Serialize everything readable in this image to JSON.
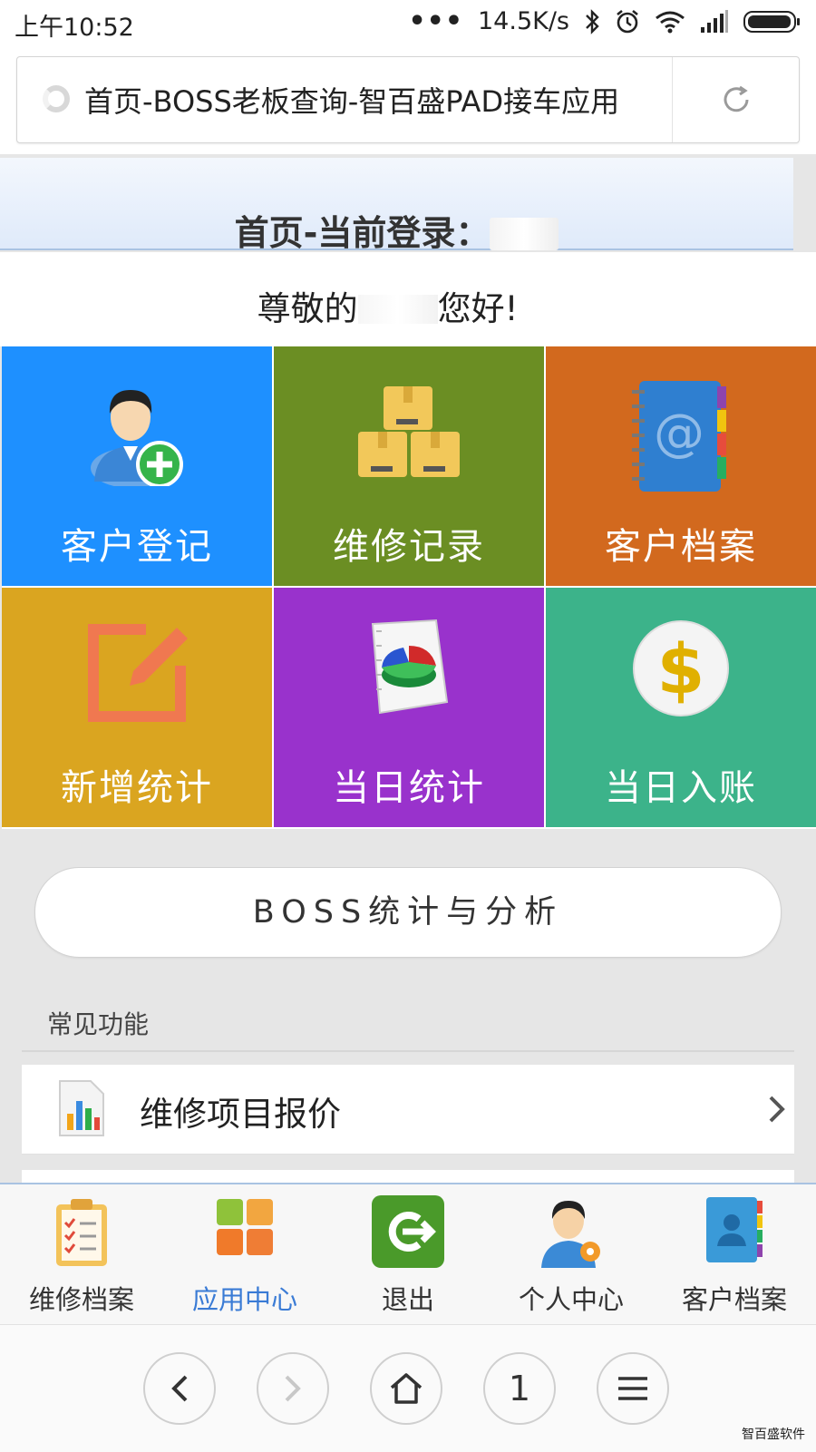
{
  "status_bar": {
    "time": "上午10:52",
    "dots": "•••",
    "network_speed": "14.5K/s",
    "icons": [
      "bluetooth-icon",
      "alarm-icon",
      "wifi-icon",
      "signal-icon",
      "battery-icon"
    ]
  },
  "browser": {
    "page_title": "首页-BOSS老板查询-智百盛PAD接车应用"
  },
  "header": {
    "title_prefix": "首页-当前登录："
  },
  "greeting": {
    "prefix": "尊敬的",
    "suffix": "您好!"
  },
  "tiles": [
    {
      "label": "客户登记",
      "color": "#1e90ff",
      "icon": "add-user-icon"
    },
    {
      "label": "维修记录",
      "color": "#6b8e23",
      "icon": "boxes-icon"
    },
    {
      "label": "客户档案",
      "color": "#d2691e",
      "icon": "address-book-icon"
    },
    {
      "label": "新增统计",
      "color": "#daa520",
      "icon": "edit-icon"
    },
    {
      "label": "当日统计",
      "color": "#9932cc",
      "icon": "pie-chart-icon"
    },
    {
      "label": "当日入账",
      "color": "#3cb38a",
      "icon": "dollar-coin-icon"
    }
  ],
  "boss_button": {
    "label": "BOSS统计与分析"
  },
  "common_functions": {
    "title": "常见功能",
    "items": [
      {
        "label": "维修项目报价",
        "icon": "bar-chart-document-icon"
      }
    ]
  },
  "tabbar": {
    "items": [
      {
        "label": "维修档案",
        "icon": "clipboard-checklist-icon",
        "active": false
      },
      {
        "label": "应用中心",
        "icon": "app-grid-icon",
        "active": true
      },
      {
        "label": "退出",
        "icon": "logout-icon",
        "active": false
      },
      {
        "label": "个人中心",
        "icon": "user-profile-icon",
        "active": false
      },
      {
        "label": "客户档案",
        "icon": "contacts-book-icon",
        "active": false
      }
    ],
    "active_color": "#3a7bd5"
  },
  "browser_nav": {
    "tab_count": "1"
  },
  "watermark": "智百盛软件"
}
